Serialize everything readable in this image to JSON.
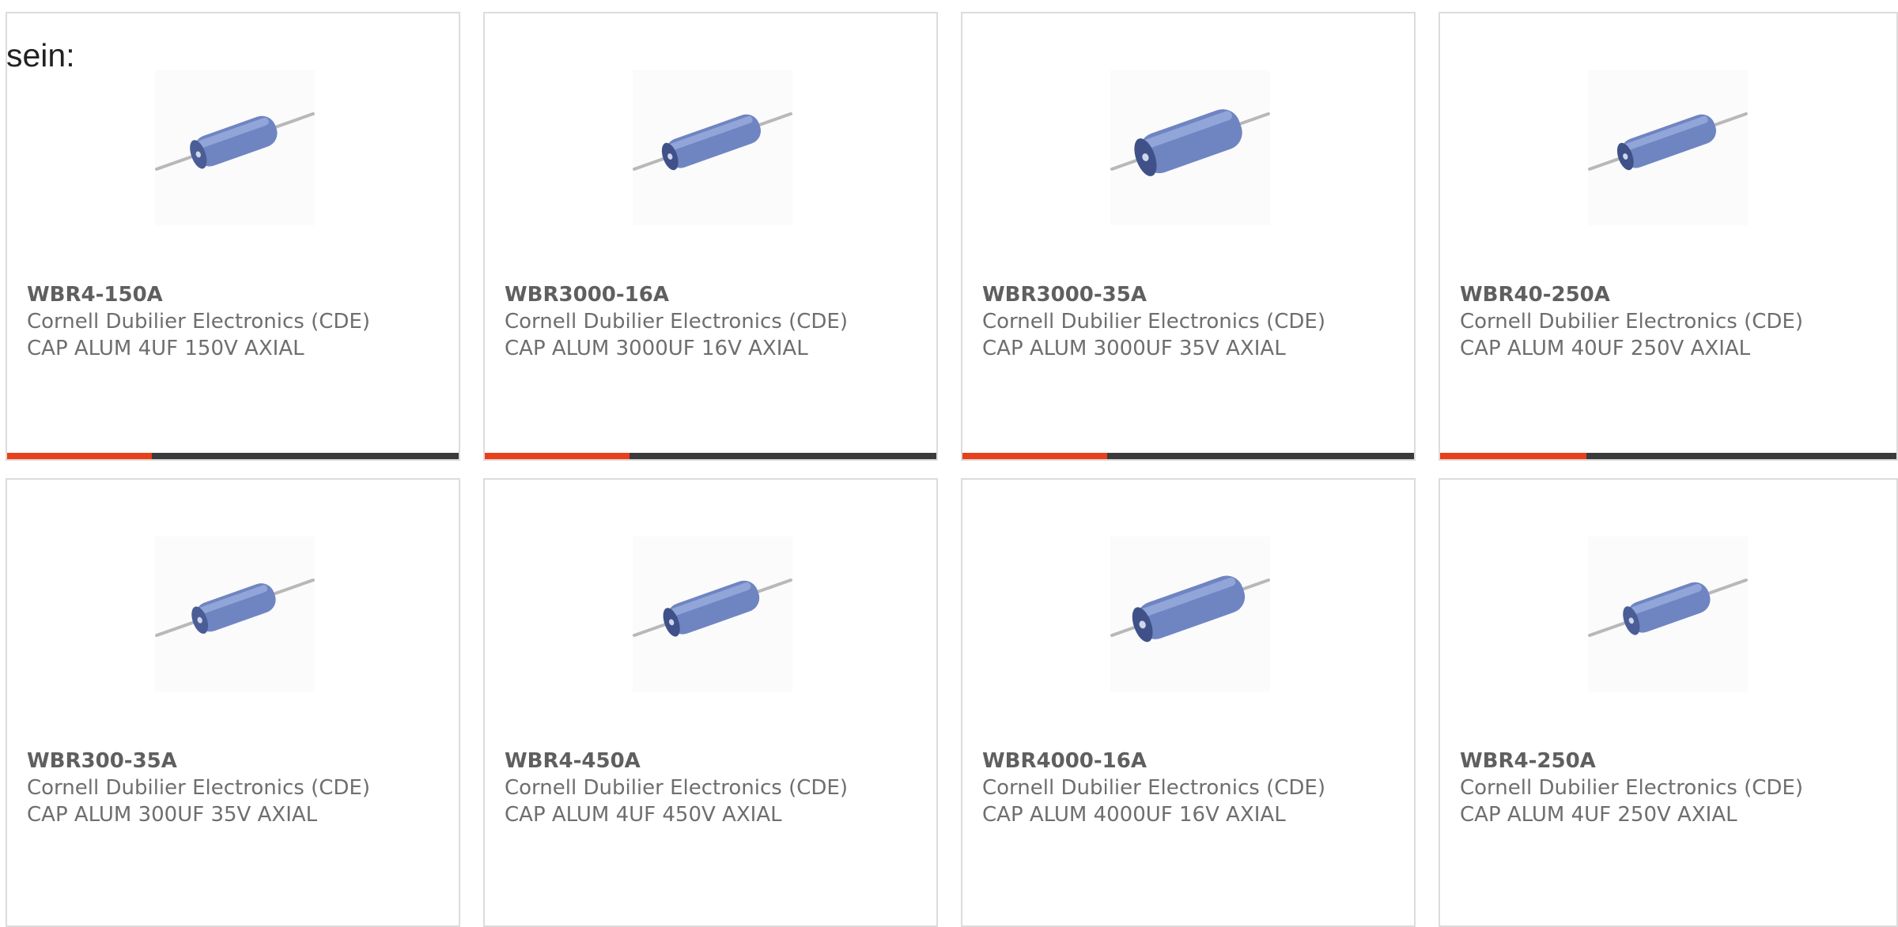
{
  "intro_text": "sein:",
  "colors": {
    "accent": "#e8401a",
    "bar_dark": "#3b3b3b",
    "card_border": "#dcdcdc",
    "capacitor_body": "#6f85c2"
  },
  "products": [
    {
      "part_number": "WBR4-150A",
      "manufacturer": "Cornell Dubilier Electronics (CDE)",
      "description": "CAP ALUM 4UF 150V AXIAL",
      "image_icon": "axial-capacitor-icon",
      "progress": 0.32
    },
    {
      "part_number": "WBR3000-16A",
      "manufacturer": "Cornell Dubilier Electronics (CDE)",
      "description": "CAP ALUM 3000UF 16V AXIAL",
      "image_icon": "axial-capacitor-icon",
      "progress": 0.32
    },
    {
      "part_number": "WBR3000-35A",
      "manufacturer": "Cornell Dubilier Electronics (CDE)",
      "description": "CAP ALUM 3000UF 35V AXIAL",
      "image_icon": "axial-capacitor-icon",
      "progress": 0.32
    },
    {
      "part_number": "WBR40-250A",
      "manufacturer": "Cornell Dubilier Electronics (CDE)",
      "description": "CAP ALUM 40UF 250V AXIAL",
      "image_icon": "axial-capacitor-icon",
      "progress": 0.32
    },
    {
      "part_number": "WBR300-35A",
      "manufacturer": "Cornell Dubilier Electronics (CDE)",
      "description": "CAP ALUM 300UF 35V AXIAL",
      "image_icon": "axial-capacitor-icon",
      "progress": null
    },
    {
      "part_number": "WBR4-450A",
      "manufacturer": "Cornell Dubilier Electronics (CDE)",
      "description": "CAP ALUM 4UF 450V AXIAL",
      "image_icon": "axial-capacitor-icon",
      "progress": null
    },
    {
      "part_number": "WBR4000-16A",
      "manufacturer": "Cornell Dubilier Electronics (CDE)",
      "description": "CAP ALUM 4000UF 16V AXIAL",
      "image_icon": "axial-capacitor-icon",
      "progress": null
    },
    {
      "part_number": "WBR4-250A",
      "manufacturer": "Cornell Dubilier Electronics (CDE)",
      "description": "CAP ALUM 4UF 250V AXIAL",
      "image_icon": "axial-capacitor-icon",
      "progress": null
    }
  ]
}
